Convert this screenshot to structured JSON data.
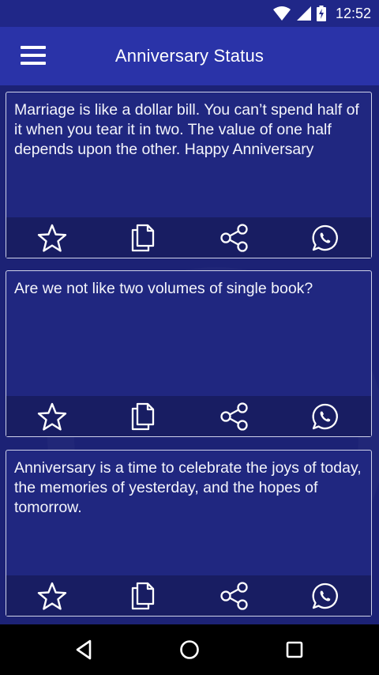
{
  "status": {
    "time": "12:52"
  },
  "app": {
    "title": "Anniversary Status"
  },
  "cards": [
    {
      "text": "Marriage is like a dollar bill. You can’t spend half of it when you tear it in two. The value of one half depends upon the other. Happy Anniversary"
    },
    {
      "text": "Are we not like two volumes of single book?"
    },
    {
      "text": "Anniversary is a time to celebrate the joys of today, the memories of yesterday, and the hopes of tomorrow."
    }
  ],
  "icons": {
    "favorite": "star-icon",
    "copy": "copy-icon",
    "share": "share-icon",
    "whatsapp": "whatsapp-icon"
  },
  "colors": {
    "appbar": "#2a33a8",
    "background": "#1c2275",
    "card": "#202780",
    "card_actions": "#181d62"
  }
}
